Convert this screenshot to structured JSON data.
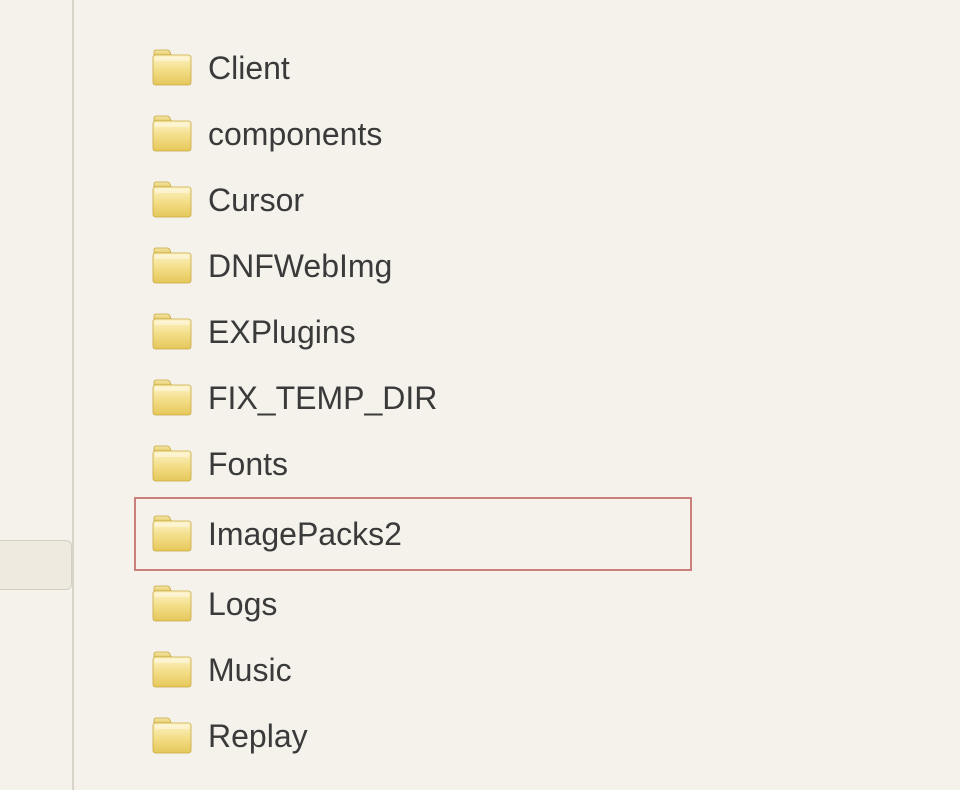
{
  "fileList": {
    "items": [
      {
        "name": "Client",
        "highlighted": false
      },
      {
        "name": "components",
        "highlighted": false
      },
      {
        "name": "Cursor",
        "highlighted": false
      },
      {
        "name": "DNFWebImg",
        "highlighted": false
      },
      {
        "name": "EXPlugins",
        "highlighted": false
      },
      {
        "name": "FIX_TEMP_DIR",
        "highlighted": false
      },
      {
        "name": "Fonts",
        "highlighted": false
      },
      {
        "name": "ImagePacks2",
        "highlighted": true
      },
      {
        "name": "Logs",
        "highlighted": false
      },
      {
        "name": "Music",
        "highlighted": false
      },
      {
        "name": "Replay",
        "highlighted": false
      }
    ]
  }
}
